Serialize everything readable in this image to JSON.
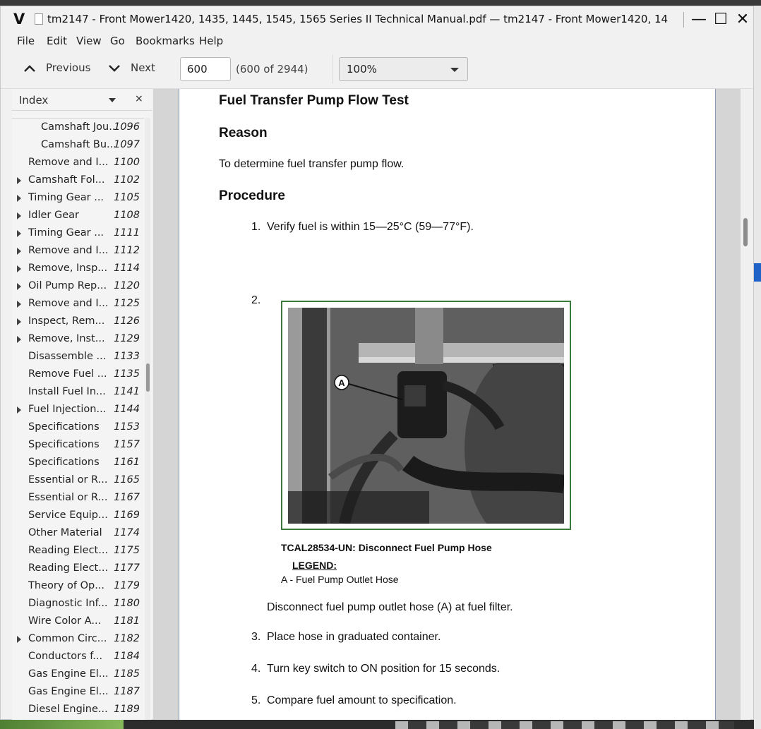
{
  "window": {
    "app_logo": "V",
    "title": "tm2147 - Front Mower1420, 1435, 1445, 1545, 1565 Series II Technical Manual.pdf — tm2147 - Front Mower1420, 1435, 1445, 1545, 1565 Series II Technical Manual.pdf",
    "minimize": "—",
    "maximize": "☐",
    "close": "✕"
  },
  "menu": [
    "File",
    "Edit",
    "View",
    "Go",
    "Bookmarks",
    "Help"
  ],
  "toolbar": {
    "previous_label": "Previous",
    "next_label": "Next",
    "page_value": "600",
    "page_count": "(600 of 2944)",
    "zoom_value": "100%"
  },
  "sidebar": {
    "title": "Index",
    "close": "×",
    "items": [
      {
        "label": "Camshaft Jou...",
        "page": "1096",
        "indent": 2,
        "expandable": false
      },
      {
        "label": "Camshaft Bu...",
        "page": "1097",
        "indent": 2,
        "expandable": false
      },
      {
        "label": "Remove and I...",
        "page": "1100",
        "indent": 1,
        "expandable": false
      },
      {
        "label": "Camshaft Fol...",
        "page": "1102",
        "indent": 1,
        "expandable": true
      },
      {
        "label": "Timing Gear ...",
        "page": "1105",
        "indent": 1,
        "expandable": true
      },
      {
        "label": "Idler Gear",
        "page": "1108",
        "indent": 1,
        "expandable": true
      },
      {
        "label": "Timing Gear ...",
        "page": "1111",
        "indent": 1,
        "expandable": true
      },
      {
        "label": "Remove and I...",
        "page": "1112",
        "indent": 1,
        "expandable": true
      },
      {
        "label": "Remove, Insp...",
        "page": "1114",
        "indent": 1,
        "expandable": true
      },
      {
        "label": "Oil Pump Rep...",
        "page": "1120",
        "indent": 1,
        "expandable": true
      },
      {
        "label": "Remove and I...",
        "page": "1125",
        "indent": 1,
        "expandable": true
      },
      {
        "label": "Inspect, Rem...",
        "page": "1126",
        "indent": 1,
        "expandable": true
      },
      {
        "label": "Remove, Inst...",
        "page": "1129",
        "indent": 1,
        "expandable": true
      },
      {
        "label": "Disassemble ...",
        "page": "1133",
        "indent": 1,
        "expandable": false
      },
      {
        "label": "Remove Fuel ...",
        "page": "1135",
        "indent": 1,
        "expandable": false
      },
      {
        "label": "Install Fuel In...",
        "page": "1141",
        "indent": 1,
        "expandable": false
      },
      {
        "label": "Fuel Injection...",
        "page": "1144",
        "indent": 1,
        "expandable": true
      },
      {
        "label": "Specifications",
        "page": "1153",
        "indent": 1,
        "expandable": false
      },
      {
        "label": "Specifications",
        "page": "1157",
        "indent": 1,
        "expandable": false
      },
      {
        "label": "Specifications",
        "page": "1161",
        "indent": 1,
        "expandable": false
      },
      {
        "label": "Essential or R...",
        "page": "1165",
        "indent": 1,
        "expandable": false
      },
      {
        "label": "Essential or R...",
        "page": "1167",
        "indent": 1,
        "expandable": false
      },
      {
        "label": "Service Equip...",
        "page": "1169",
        "indent": 1,
        "expandable": false
      },
      {
        "label": "Other Material",
        "page": "1174",
        "indent": 1,
        "expandable": false
      },
      {
        "label": "Reading Elect...",
        "page": "1175",
        "indent": 1,
        "expandable": false
      },
      {
        "label": "Reading Elect...",
        "page": "1177",
        "indent": 1,
        "expandable": false
      },
      {
        "label": "Theory of Op...",
        "page": "1179",
        "indent": 1,
        "expandable": false
      },
      {
        "label": "Diagnostic Inf...",
        "page": "1180",
        "indent": 1,
        "expandable": false
      },
      {
        "label": "Wire Color A...",
        "page": "1181",
        "indent": 1,
        "expandable": false
      },
      {
        "label": "Common Circ...",
        "page": "1182",
        "indent": 1,
        "expandable": true
      },
      {
        "label": "Conductors f...",
        "page": "1184",
        "indent": 1,
        "expandable": false
      },
      {
        "label": "Gas Engine El...",
        "page": "1185",
        "indent": 1,
        "expandable": false
      },
      {
        "label": "Gas Engine El...",
        "page": "1187",
        "indent": 1,
        "expandable": false
      },
      {
        "label": "Diesel Engine...",
        "page": "1189",
        "indent": 1,
        "expandable": false
      }
    ]
  },
  "document": {
    "title": "Fuel Transfer Pump Flow Test",
    "reason_heading": "Reason",
    "reason_text": "To determine fuel transfer pump flow.",
    "procedure_heading": "Procedure",
    "steps": [
      {
        "num": "1.",
        "text": "Verify fuel is within 15—25°C (59—77°F)."
      },
      {
        "num": "2.",
        "text": "Disconnect fuel pump outlet hose (A) at fuel filter."
      },
      {
        "num": "3.",
        "text": "Place hose in graduated container."
      },
      {
        "num": "4.",
        "text": "Turn key switch to ON position for 15 seconds."
      },
      {
        "num": "5.",
        "text": "Compare fuel amount to specification."
      }
    ],
    "figure_callout": "A",
    "figure_caption": "TCAL28534-UN: Disconnect Fuel Pump Hose",
    "legend_heading": "LEGEND:",
    "legend_item": "A - Fuel Pump Outlet Hose"
  },
  "colors": {
    "figure_border": "#3a7a3a",
    "page_border": "#8a9bb8",
    "selection_blue": "#1f63c9"
  }
}
